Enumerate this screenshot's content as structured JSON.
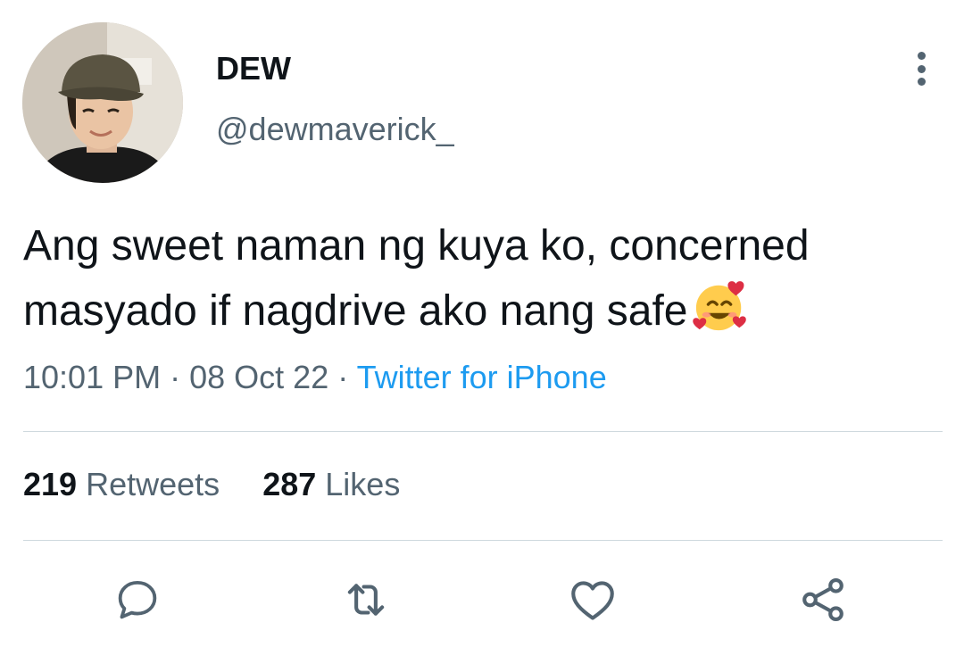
{
  "author": {
    "display_name": "DEW",
    "handle": "@dewmaverick_",
    "avatar": "profile-photo"
  },
  "tweet": {
    "text": "Ang sweet naman ng kuya ko, concerned masyado if nagdrive ako nang safe",
    "emoji": "smiling-face-with-hearts",
    "time": "10:01 PM",
    "date": "08 Oct 22",
    "separator": "·",
    "source": "Twitter for iPhone"
  },
  "stats": {
    "retweets_count": "219",
    "retweets_label": "Retweets",
    "likes_count": "287",
    "likes_label": "Likes"
  },
  "actions": {
    "reply_icon": "reply-icon",
    "retweet_icon": "retweet-icon",
    "like_icon": "heart-icon",
    "share_icon": "share-icon",
    "more_icon": "more-vertical-icon"
  },
  "colors": {
    "text_primary": "#0f1419",
    "text_secondary": "#536471",
    "link": "#1d9bf0",
    "divider": "#cfd9de"
  }
}
